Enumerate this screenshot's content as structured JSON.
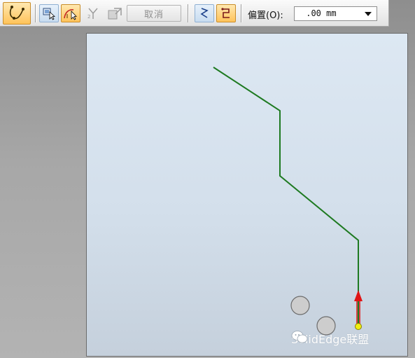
{
  "toolbar": {
    "cancel_label": "取消",
    "offset_label": "偏置(O):",
    "offset_value": " .00 mm"
  },
  "icons": {
    "path_tool": "path-curve-icon",
    "select_tool": "select-window-icon",
    "arc_select": "arc-select-icon",
    "branch_tool": "branch-icon",
    "finish_tool": "finish-icon",
    "open_path": "open-path-icon",
    "closed_path": "closed-path-icon"
  },
  "colors": {
    "path_line": "#1e7a21",
    "arrow": "#e01515",
    "endpoint": "#f1ee12",
    "active_button": "#ffc35a"
  },
  "watermark": {
    "text": "SolidEdge联盟"
  }
}
